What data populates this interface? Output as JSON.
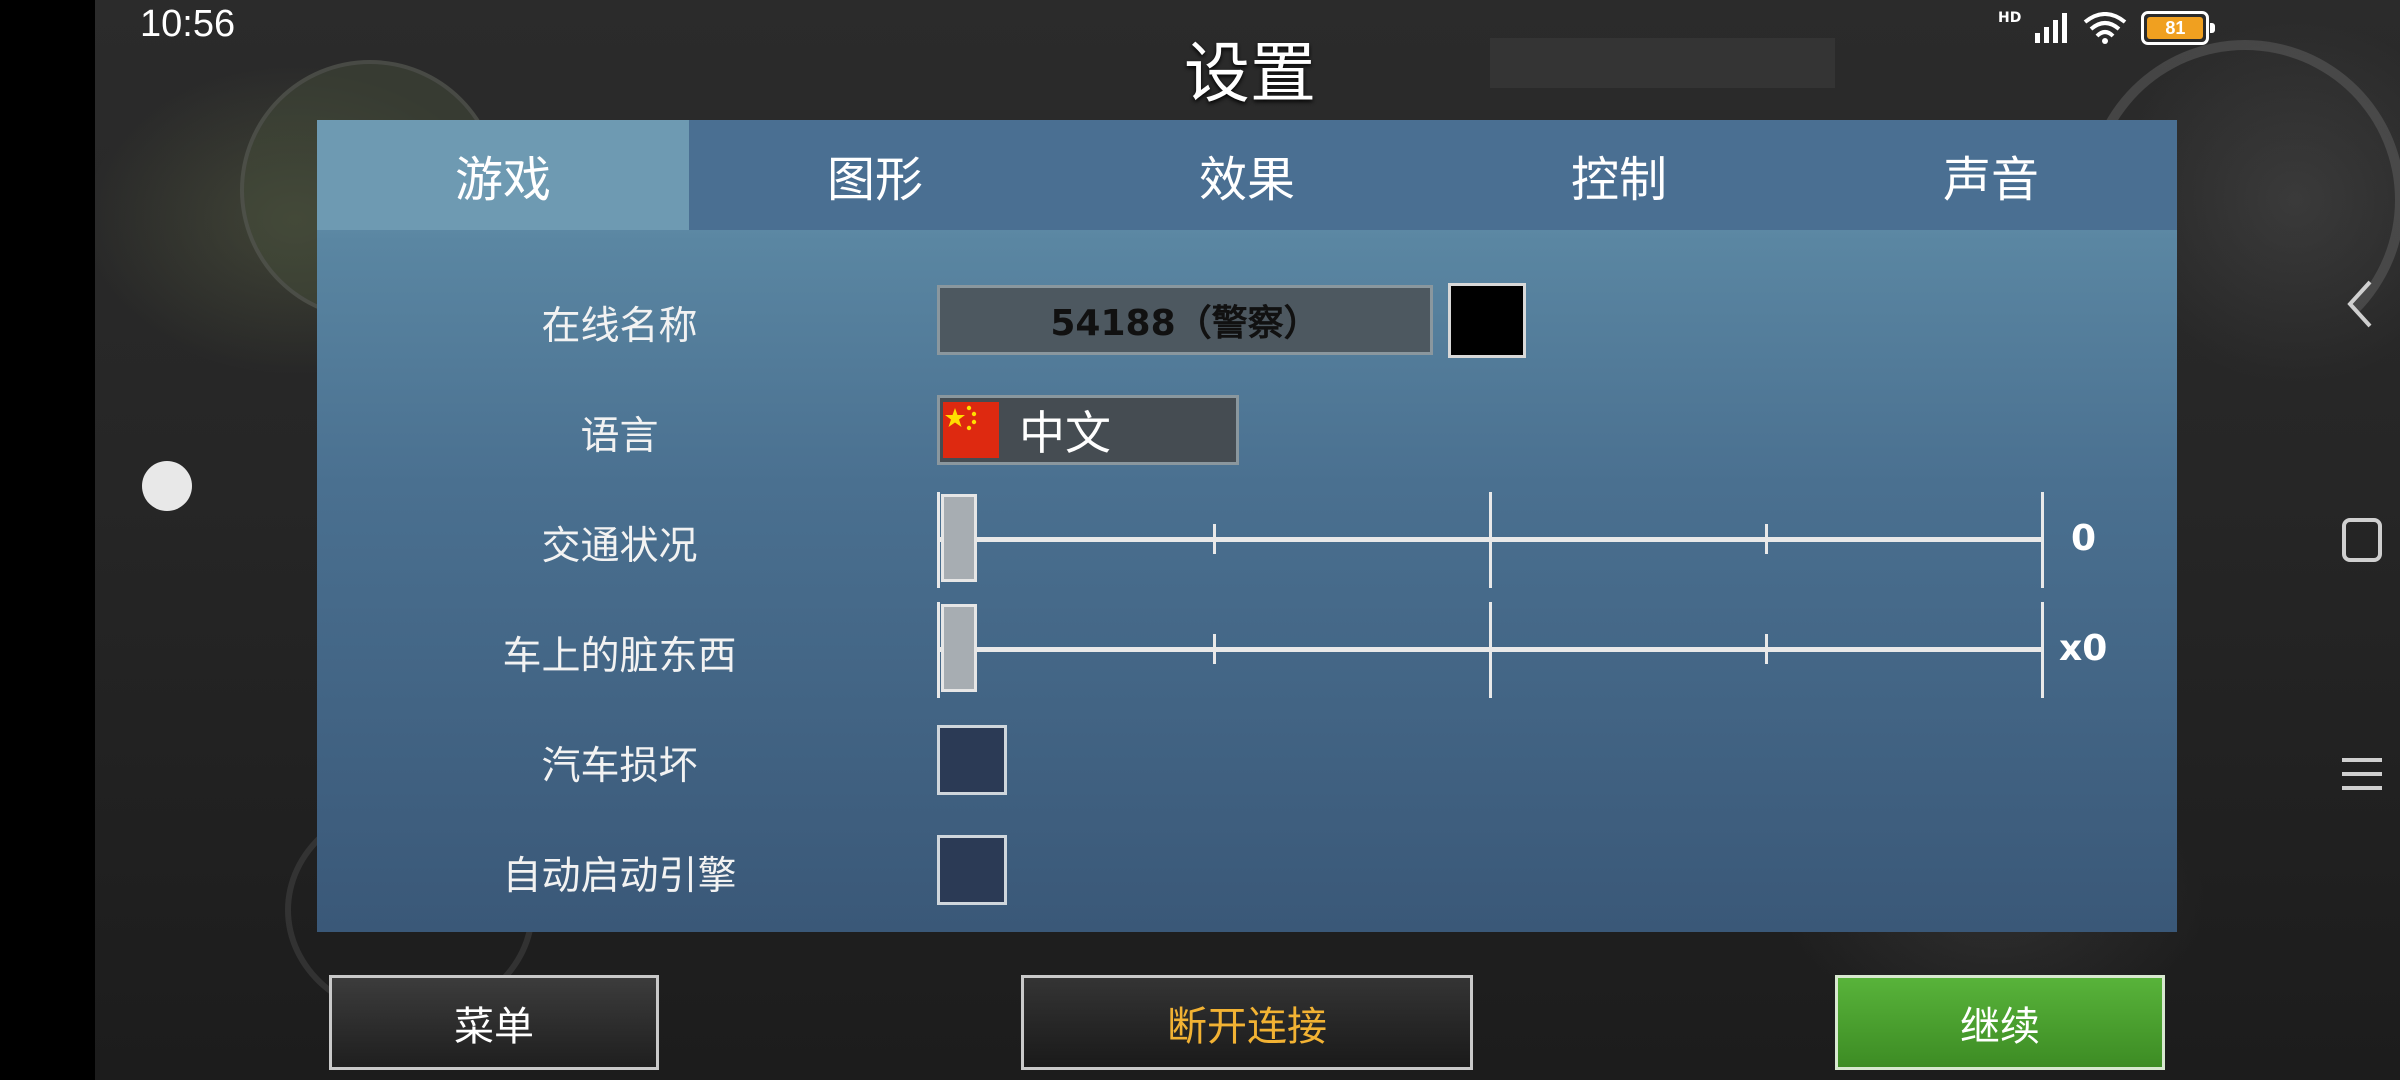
{
  "status_bar": {
    "time": "10:56",
    "network_label": "HD",
    "battery": "81"
  },
  "dialog": {
    "title": "设置"
  },
  "tabs": [
    {
      "label": "游戏",
      "active": true
    },
    {
      "label": "图形",
      "active": false
    },
    {
      "label": "效果",
      "active": false
    },
    {
      "label": "控制",
      "active": false
    },
    {
      "label": "声音",
      "active": false
    }
  ],
  "settings": {
    "online_name": {
      "label": "在线名称",
      "value": "54188（警察）",
      "color": "#000000"
    },
    "language": {
      "label": "语言",
      "value": "中文",
      "flag": "china-flag-icon"
    },
    "traffic": {
      "label": "交通状况",
      "value_text": "0",
      "level": 0
    },
    "car_dirt": {
      "label": "车上的脏东西",
      "value_text": "x0",
      "level": 0
    },
    "car_damage": {
      "label": "汽车损坏",
      "checked": false
    },
    "auto_start_engine": {
      "label": "自动启动引擎",
      "checked": false
    }
  },
  "buttons": {
    "menu": "菜单",
    "disconnect": "断开连接",
    "continue": "继续"
  },
  "colors": {
    "tab_active": "#6e9ab2",
    "disconnect_text": "#f2b233",
    "continue_bg": "#4fa02f"
  }
}
